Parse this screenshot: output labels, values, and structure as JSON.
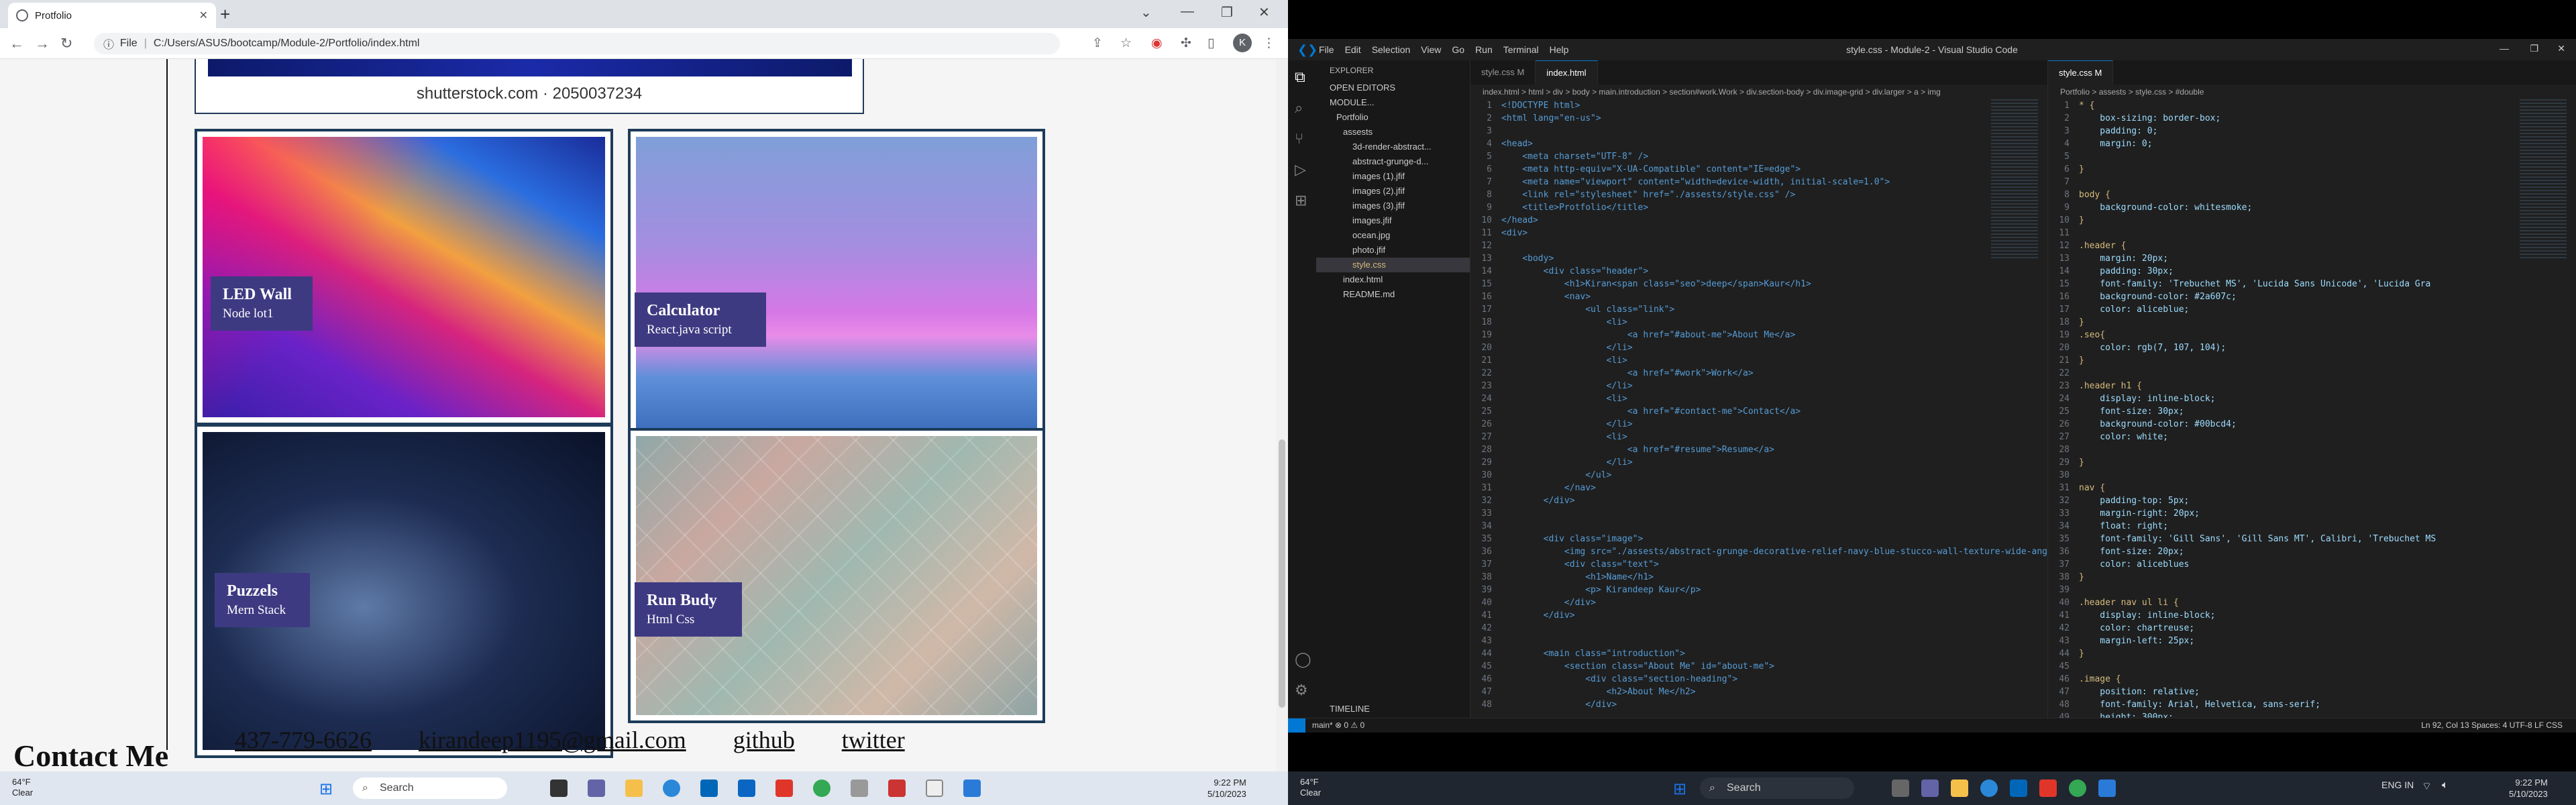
{
  "browser": {
    "tab_title": "Protfolio",
    "url_scheme": "File",
    "url": "C:/Users/ASUS/bootcamp/Module-2/Portfolio/index.html",
    "avatar_letter": "K"
  },
  "page": {
    "top_image_caption": "shutterstock.com · 2050037234",
    "cards": [
      {
        "title": "LED Wall",
        "subtitle": "Node lot1"
      },
      {
        "title": "Calculator",
        "subtitle": "React.java script"
      },
      {
        "title": "Puzzels",
        "subtitle": "Mern Stack"
      },
      {
        "title": "Run Budy",
        "subtitle": "Html Css"
      }
    ],
    "contact_title": "Contact Me",
    "contact_links": [
      "437-779-6626",
      "kirandeep1195@gmail.com",
      "github",
      "twitter"
    ]
  },
  "taskbar_left": {
    "temp": "64°F",
    "condition": "Clear",
    "search": "Search",
    "time": "9:22 PM",
    "date": "5/10/2023"
  },
  "vscode": {
    "menu": [
      "File",
      "Edit",
      "Selection",
      "View",
      "Go",
      "Run",
      "Terminal",
      "Help"
    ],
    "title": "style.css - Module-2 - Visual Studio Code",
    "explorer_label": "EXPLORER",
    "open_editors": "OPEN EDITORS",
    "workspace": "MODULE...",
    "tree": [
      "Portfolio",
      "assests",
      "3d-render-abstract...",
      "abstract-grunge-d...",
      "images (1).jfif",
      "images (2).jfif",
      "images (3).jfif",
      "images.jfif",
      "ocean.jpg",
      "photo.jfif",
      "style.css",
      "index.html",
      "README.md"
    ],
    "timeline": "TIMELINE",
    "left_tabs": [
      "style.css M",
      "index.html"
    ],
    "left_crumbs": "index.html > html > div > body > main.introduction > section#work.Work > div.section-body > div.image-grid > div.larger > a > img",
    "right_tabs": [
      "style.css M"
    ],
    "right_crumbs": "Portfolio > assests > style.css > #double",
    "status_left": "main*  ⊗ 0 ⚠ 0",
    "status_right": "Ln 92, Col 13   Spaces: 4   UTF-8   LF   CSS"
  },
  "taskbar_right": {
    "temp": "64°F",
    "condition": "Clear",
    "search": "Search",
    "lang": "ENG IN",
    "time": "9:22 PM",
    "date": "5/10/2023"
  },
  "html_code": [
    "<!DOCTYPE html>",
    "<html lang=\"en-us\">",
    "",
    "<head>",
    "    <meta charset=\"UTF-8\" />",
    "    <meta http-equiv=\"X-UA-Compatible\" content=\"IE=edge\">",
    "    <meta name=\"viewport\" content=\"width=device-width, initial-scale=1.0\">",
    "    <link rel=\"stylesheet\" href=\"./assests/style.css\" />",
    "    <title>Protfolio</title>",
    "</head>",
    "<div>",
    "",
    "    <body>",
    "        <div class=\"header\">",
    "            <h1>Kiran<span class=\"seo\">deep</span>Kaur</h1>",
    "            <nav>",
    "                <ul class=\"link\">",
    "                    <li>",
    "                        <a href=\"#about-me\">About Me</a>",
    "                    </li>",
    "                    <li>",
    "                        <a href=\"#work\">Work</a>",
    "                    </li>",
    "                    <li>",
    "                        <a href=\"#contact-me\">Contact</a>",
    "                    </li>",
    "                    <li>",
    "                        <a href=\"#resume\">Resume</a>",
    "                    </li>",
    "                </ul>",
    "            </nav>",
    "        </div>",
    "",
    "",
    "        <div class=\"image\">",
    "            <img src=\"./assests/abstract-grunge-decorative-relief-navy-blue-stucco-wall-texture-wide-angle-",
    "            <div class=\"text\">",
    "                <h1>Name</h1>",
    "                <p> Kirandeep Kaur</p>",
    "            </div>",
    "        </div>",
    "",
    "",
    "        <main class=\"introduction\">",
    "            <section class=\"About Me\" id=\"about-me\">",
    "                <div class=\"section-heading\">",
    "                    <h2>About Me</h2>",
    "                </div>"
  ],
  "css_code": [
    "* {",
    "    box-sizing: border-box;",
    "    padding: 0;",
    "    margin: 0;",
    "",
    "}",
    "",
    "body {",
    "    background-color: whitesmoke;",
    "}",
    "",
    ".header {",
    "    margin: 20px;",
    "    padding: 30px;",
    "    font-family: 'Trebuchet MS', 'Lucida Sans Unicode', 'Lucida Gra",
    "    background-color: #2a607c;",
    "    color: aliceblue;",
    "}",
    ".seo{",
    "    color: rgb(7, 107, 104);",
    "}",
    "",
    ".header h1 {",
    "    display: inline-block;",
    "    font-size: 30px;",
    "    background-color: #00bcd4;",
    "    color: white;",
    "",
    "}",
    "",
    "nav {",
    "    padding-top: 5px;",
    "    margin-right: 20px;",
    "    float: right;",
    "    font-family: 'Gill Sans', 'Gill Sans MT', Calibri, 'Trebuchet MS",
    "    font-size: 20px;",
    "    color: aliceblues",
    "}",
    "",
    ".header nav ul li {",
    "    display: inline-block;",
    "    color: chartreuse;",
    "    margin-left: 25px;",
    "}",
    "",
    ".image {",
    "    position: relative;",
    "    font-family: Arial, Helvetica, sans-serif;",
    "    height: 300px;"
  ]
}
